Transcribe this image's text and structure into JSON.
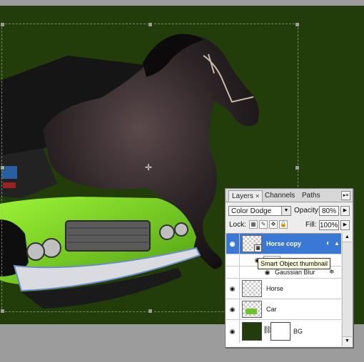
{
  "layers_panel": {
    "tabs": [
      {
        "label": "Layers",
        "close": "×"
      },
      {
        "label": "Channels"
      },
      {
        "label": "Paths"
      }
    ],
    "menu_glyph": "▸≡",
    "blend_mode": "Color Dodge",
    "opacity_label": "Opacity:",
    "opacity_value": "80%",
    "lock_label": "Lock:",
    "fill_label": "Fill:",
    "fill_value": "100%",
    "layers": [
      {
        "name": "Horse copy",
        "selected": true
      },
      {
        "name": "Gaussian Blur",
        "type": "smart-filter"
      },
      {
        "name": "Horse"
      },
      {
        "name": "Car"
      },
      {
        "name": "BG"
      }
    ]
  },
  "tooltip": "Smart Object thumbnail",
  "colors": {
    "canvas_bg": "#223c0a",
    "workspace_bg": "#9c9c9c",
    "selected_layer": "#3a78d6",
    "panel_bg": "#ececec"
  }
}
